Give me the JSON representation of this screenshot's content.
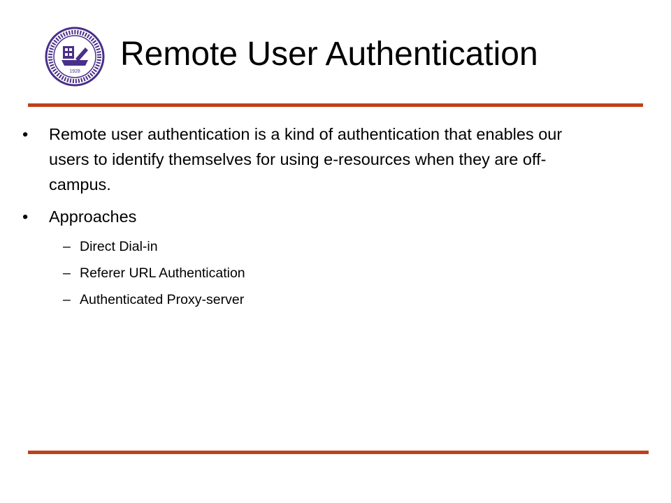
{
  "slide": {
    "title": "Remote User Authentication",
    "logo": {
      "icon": "university-seal-icon",
      "seal_text": "1928",
      "colors": {
        "ring": "#4a2f8a",
        "fill": "#ffffff"
      }
    },
    "accent_color": "#c0401a",
    "bullets": [
      {
        "text": "Remote user authentication is a kind of authentication that enables our users to identify themselves for using e-resources when they are off-campus.",
        "marker": "•"
      },
      {
        "text": "Approaches",
        "marker": "•",
        "subitems": [
          {
            "marker": "–",
            "text": "Direct Dial-in"
          },
          {
            "marker": "–",
            "text": "Referer URL Authentication"
          },
          {
            "marker": "–",
            "text": "Authenticated Proxy-server"
          }
        ]
      }
    ]
  }
}
